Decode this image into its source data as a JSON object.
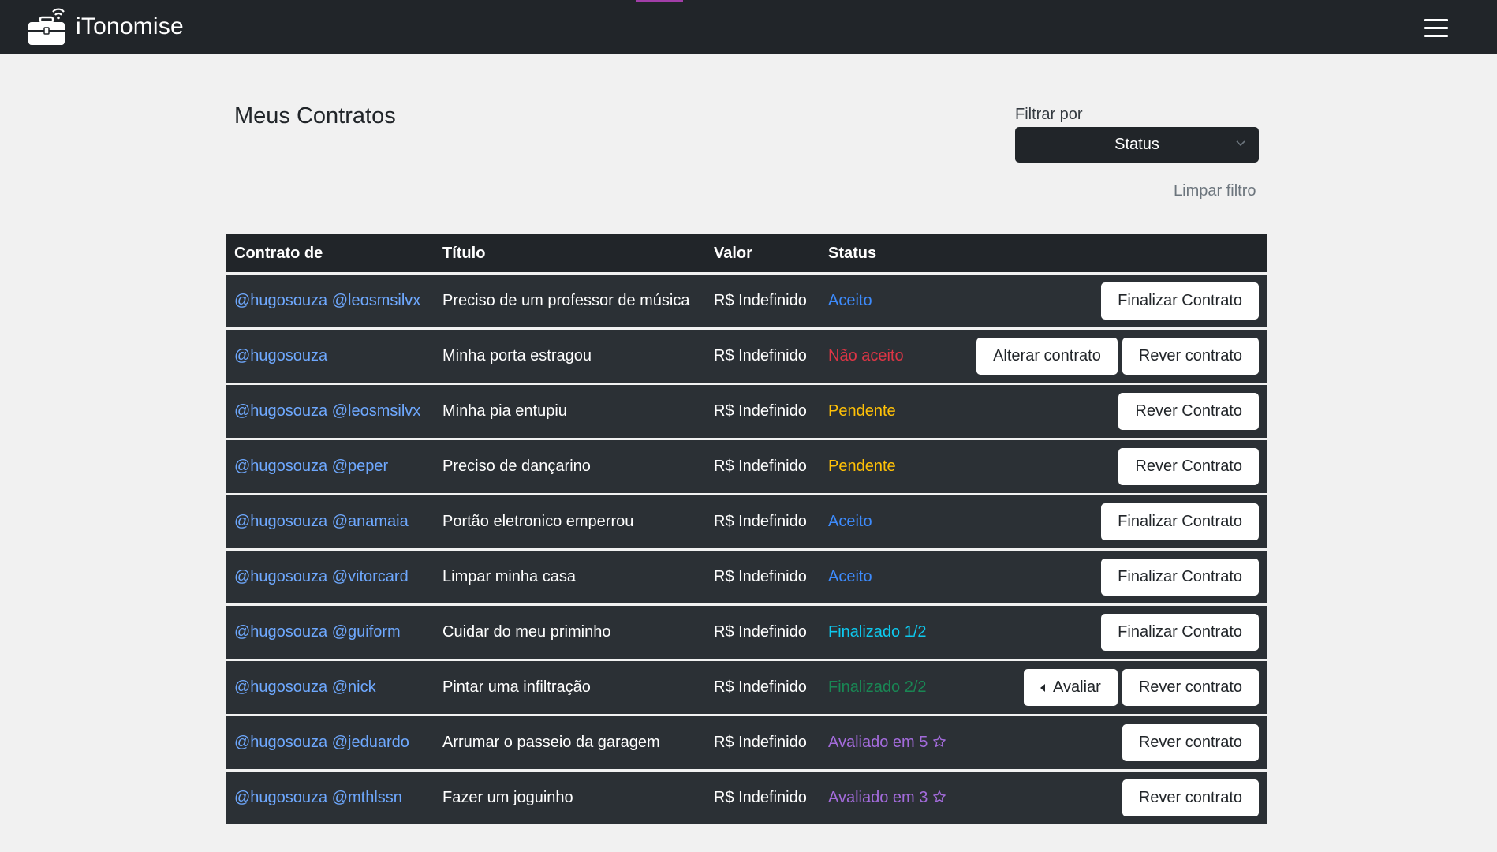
{
  "app": {
    "name": "iTonomise"
  },
  "page": {
    "title": "Meus Contratos"
  },
  "filter": {
    "label": "Filtrar por",
    "selected": "Status",
    "clear_label": "Limpar filtro"
  },
  "colors": {
    "accent_blue": "#6ea8fe",
    "status_aceito": "#3d8bfd",
    "status_nao_aceito": "#dc3545",
    "status_pendente": "#ffc107",
    "status_finalizado_1": "#0dcaf0",
    "status_finalizado_2": "#198754",
    "status_avaliado": "#a36bdb"
  },
  "table": {
    "headers": {
      "contrato_de": "Contrato de",
      "titulo": "Título",
      "valor": "Valor",
      "status": "Status"
    },
    "rows": [
      {
        "who": "@hugosouza @leosmsilvx",
        "title": "Preciso de um professor de música",
        "value": "R$ Indefinido",
        "status": "Aceito",
        "status_color": "#3d8bfd",
        "rated": false,
        "actions": [
          "Finalizar Contrato"
        ]
      },
      {
        "who": "@hugosouza",
        "title": "Minha porta estragou",
        "value": "R$ Indefinido",
        "status": "Não aceito",
        "status_color": "#dc3545",
        "rated": false,
        "actions": [
          "Alterar contrato",
          "Rever contrato"
        ]
      },
      {
        "who": "@hugosouza @leosmsilvx",
        "title": "Minha pia entupiu",
        "value": "R$ Indefinido",
        "status": "Pendente",
        "status_color": "#ffc107",
        "rated": false,
        "actions": [
          "Rever Contrato"
        ]
      },
      {
        "who": "@hugosouza @peper",
        "title": "Preciso de dançarino",
        "value": "R$ Indefinido",
        "status": "Pendente",
        "status_color": "#ffc107",
        "rated": false,
        "actions": [
          "Rever Contrato"
        ]
      },
      {
        "who": "@hugosouza @anamaia",
        "title": "Portão eletronico emperrou",
        "value": "R$ Indefinido",
        "status": "Aceito",
        "status_color": "#3d8bfd",
        "rated": false,
        "actions": [
          "Finalizar Contrato"
        ]
      },
      {
        "who": "@hugosouza @vitorcard",
        "title": "Limpar minha casa",
        "value": "R$ Indefinido",
        "status": "Aceito",
        "status_color": "#3d8bfd",
        "rated": false,
        "actions": [
          "Finalizar Contrato"
        ]
      },
      {
        "who": "@hugosouza @guiform",
        "title": "Cuidar do meu priminho",
        "value": "R$ Indefinido",
        "status": "Finalizado 1/2",
        "status_color": "#0dcaf0",
        "rated": false,
        "actions": [
          "Finalizar Contrato"
        ]
      },
      {
        "who": "@hugosouza @nick",
        "title": "Pintar uma infiltração",
        "value": "R$ Indefinido",
        "status": "Finalizado 2/2",
        "status_color": "#198754",
        "rated": false,
        "actions": [
          "Avaliar",
          "Rever contrato"
        ]
      },
      {
        "who": "@hugosouza @jeduardo",
        "title": "Arrumar o passeio da garagem",
        "value": "R$ Indefinido",
        "status": "Avaliado em 5",
        "status_color": "#a36bdb",
        "rated": true,
        "actions": [
          "Rever contrato"
        ]
      },
      {
        "who": "@hugosouza @mthlssn",
        "title": "Fazer um joguinho",
        "value": "R$ Indefinido",
        "status": "Avaliado em 3",
        "status_color": "#a36bdb",
        "rated": true,
        "actions": [
          "Rever contrato"
        ]
      }
    ]
  }
}
